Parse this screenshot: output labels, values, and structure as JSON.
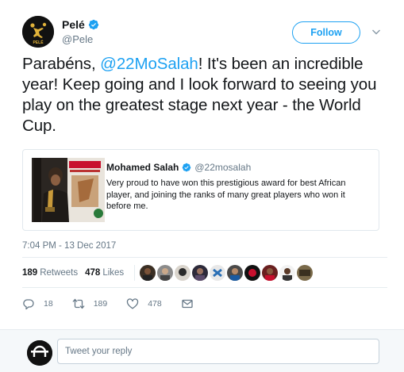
{
  "author": {
    "display_name": "Pelé",
    "handle": "@Pele",
    "avatar_logo_text": "PELÉ"
  },
  "follow_label": "Follow",
  "tweet": {
    "text_before": "Parabéns, ",
    "mention": "@22MoSalah",
    "text_after": "! It's been an incredible year! Keep going and I look forward to seeing you play on the greatest stage next year - the World Cup."
  },
  "quoted_tweet": {
    "name": "Mohamed Salah",
    "handle": "@22mosalah",
    "text": "Very proud to have won this prestigious award for best African player, and joining the ranks of many great players who won it before me."
  },
  "timestamp": "7:04 PM - 13 Dec 2017",
  "stats": {
    "retweets_count": "189",
    "retweets_label": "Retweets",
    "likes_count": "478",
    "likes_label": "Likes"
  },
  "actions": {
    "reply_count": "18",
    "retweet_count": "189",
    "like_count": "478"
  },
  "reply": {
    "placeholder": "Tweet your reply"
  },
  "colors": {
    "accent": "#1da1f2",
    "text": "#14171a",
    "muted": "#657786",
    "border": "#e6ecf0"
  },
  "icons": [
    "verified-badge-icon",
    "chevron-down-icon",
    "reply-icon",
    "retweet-icon",
    "like-heart-icon",
    "direct-message-icon"
  ]
}
